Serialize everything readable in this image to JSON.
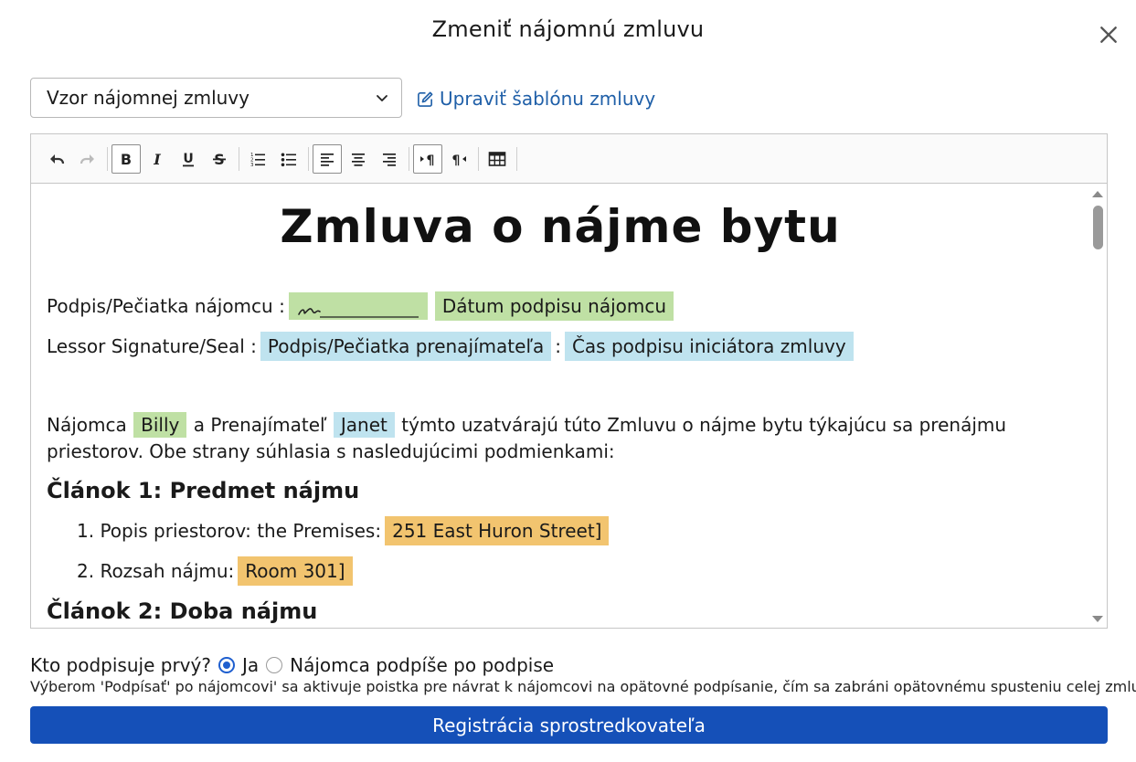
{
  "dialog": {
    "title": "Zmeniť nájomnú zmluvu",
    "close_icon": "close-icon"
  },
  "template_select": {
    "value": "Vzor nájomnej zmluvy"
  },
  "edit_link": {
    "label": "Upraviť šablónu zmluvy",
    "icon": "edit-icon"
  },
  "toolbar": {
    "buttons": [
      {
        "icon": "undo-icon",
        "active": false
      },
      {
        "icon": "redo-icon",
        "active": false
      },
      {
        "icon": "bold-icon",
        "active": true
      },
      {
        "icon": "italic-icon",
        "active": false
      },
      {
        "icon": "underline-icon",
        "active": false
      },
      {
        "icon": "strikethrough-icon",
        "active": false
      },
      {
        "icon": "ordered-list-icon",
        "active": false
      },
      {
        "icon": "bullet-list-icon",
        "active": false
      },
      {
        "icon": "align-left-icon",
        "active": true
      },
      {
        "icon": "align-center-icon",
        "active": false
      },
      {
        "icon": "align-right-icon",
        "active": false
      },
      {
        "icon": "ltr-paragraph-icon",
        "active": true
      },
      {
        "icon": "rtl-paragraph-icon",
        "active": false
      },
      {
        "icon": "table-icon",
        "active": false
      }
    ]
  },
  "document": {
    "title": "Zmluva o nájme bytu",
    "tenant_sig_label": "Podpis/Pečiatka nájomcu :",
    "tenant_date_field": "Dátum podpisu nájomcu",
    "lessor_sig_label": "Lessor Signature/Seal :",
    "lessor_sig_field": "Podpis/Pečiatka prenajímateľa",
    "lessor_colon": ":",
    "initiator_time_field": "Čas podpisu iniciátora zmluvy",
    "intro_1": "Nájomca",
    "tenant_name": "Billy",
    "intro_2": "a Prenajímateľ",
    "lessor_name": "Janet",
    "intro_3": "týmto uzatvárajú túto Zmluvu o nájme bytu týkajúcu sa prenájmu priestorov. Obe strany súhlasia s nasledujúcimi podmienkami:",
    "article1_heading": "Článok 1: Predmet nájmu",
    "item1_label": "1. Popis priestorov: the Premises:",
    "item1_value": "251 East Huron Street]",
    "item2_label": "2. Rozsah nájmu:",
    "item2_value": "Room 301]",
    "article2_heading": "Článok 2: Doba nájmu"
  },
  "signing_order": {
    "question": "Kto podpisuje prvý?",
    "option_me": "Ja",
    "option_after": "Nájomca podpíše po podpise",
    "selected": "me",
    "hint": "Výberom 'Podpísať' po nájomcovi' sa aktivuje poistka pre návrat k nájomcovi na opätovné podpísanie, čím sa zabráni opätovnému spusteniu celej zmluvy."
  },
  "primary_button": {
    "label": "Registrácia sprostredkovateľa"
  },
  "colors": {
    "primary": "#1550b8",
    "link": "#1f5fa8",
    "field_green": "#bfe0a4",
    "field_blue": "#bfe3ef",
    "field_orange": "#f2c46f"
  }
}
